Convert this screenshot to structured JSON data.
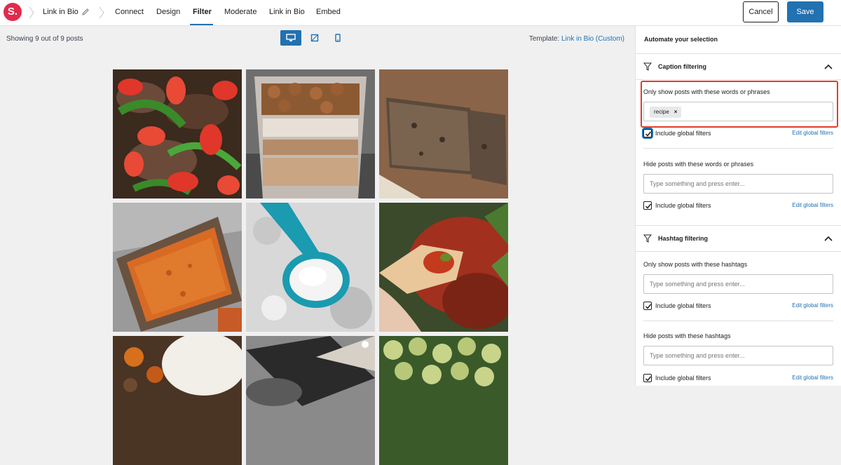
{
  "header": {
    "logo_text": "S.",
    "breadcrumb": "Link in Bio",
    "tabs": [
      "Connect",
      "Design",
      "Filter",
      "Moderate",
      "Link in Bio",
      "Embed"
    ],
    "active_tab": "Filter",
    "cancel_label": "Cancel",
    "save_label": "Save"
  },
  "preview": {
    "showing_text": "Showing 9 out of 9 posts",
    "template_label": "Template:",
    "template_value": "Link in Bio (Custom)",
    "devices": [
      "desktop-icon",
      "tablet-icon",
      "mobile-icon"
    ],
    "active_device": "desktop-icon"
  },
  "sidebar": {
    "title": "Automate your selection",
    "caption": {
      "heading": "Caption filtering",
      "show_label": "Only show posts with these words or phrases",
      "show_tag": "recipe",
      "show_global": "Include global filters",
      "edit_global": "Edit global filters",
      "hide_label": "Hide posts with these words or phrases",
      "hide_placeholder": "Type something and press enter...",
      "hide_global": "Include global filters",
      "hide_edit_global": "Edit global filters"
    },
    "hashtag": {
      "heading": "Hashtag filtering",
      "show_label": "Only show posts with these hashtags",
      "show_placeholder": "Type something and press enter...",
      "show_global": "Include global filters",
      "edit_global": "Edit global filters",
      "hide_label": "Hide posts with these hashtags",
      "hide_placeholder": "Type something and press enter...",
      "hide_global": "Include global filters",
      "hide_edit_global": "Edit global filters"
    }
  },
  "colors": {
    "accent": "#2271b1",
    "brand": "#e32a4c",
    "highlight": "#e53b2b"
  }
}
